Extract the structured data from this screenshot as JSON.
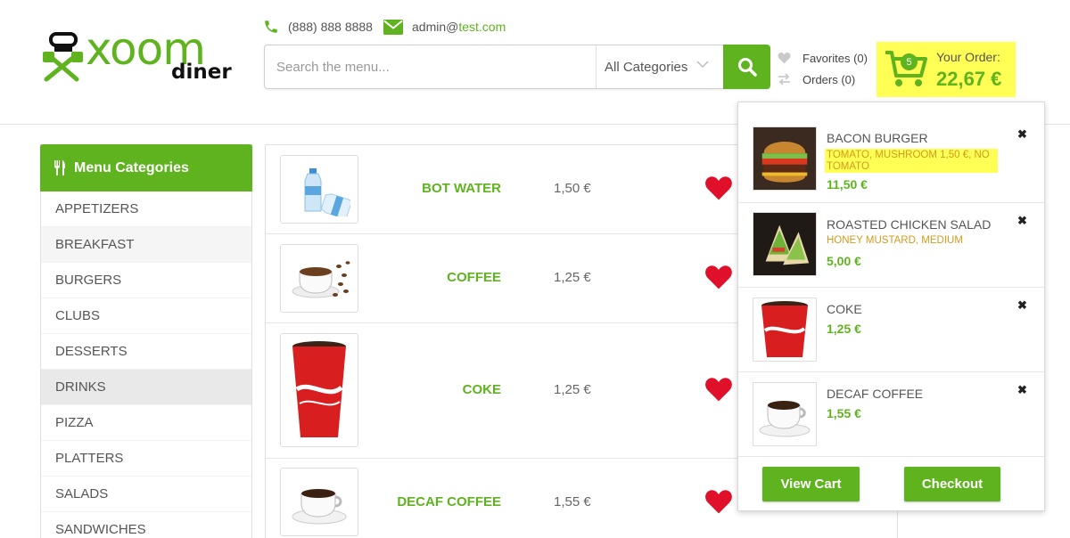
{
  "header": {
    "logo": {
      "word": "xoom",
      "sub": "diner"
    },
    "phone": "(888) 888 8888",
    "email_user": "admin@",
    "email_domain": "test.com",
    "search_placeholder": "Search the menu...",
    "category_select": "All Categories",
    "favorites": "Favorites (0)",
    "orders": "Orders (0)",
    "order_label": "Your Order:",
    "order_total": "22,67 €",
    "cart_count": "5"
  },
  "sidebar": {
    "title": "Menu Categories",
    "items": [
      {
        "label": "APPETIZERS"
      },
      {
        "label": "BREAKFAST"
      },
      {
        "label": "BURGERS"
      },
      {
        "label": "CLUBS"
      },
      {
        "label": "DESSERTS"
      },
      {
        "label": "DRINKS"
      },
      {
        "label": "PIZZA"
      },
      {
        "label": "PLATTERS"
      },
      {
        "label": "SALADS"
      },
      {
        "label": "SANDWICHES"
      }
    ]
  },
  "products": [
    {
      "name": "BOT WATER",
      "price": "1,50 €",
      "icon": "water-bottle-image"
    },
    {
      "name": "COFFEE",
      "price": "1,25 €",
      "icon": "coffee-cup-image"
    },
    {
      "name": "COKE",
      "price": "1,25 €",
      "icon": "coke-cup-image"
    },
    {
      "name": "DECAF COFFEE",
      "price": "1,55 €",
      "icon": "coffee-cup-image"
    }
  ],
  "cart": {
    "items": [
      {
        "name": "BACON BURGER",
        "options": "TOMATO, MUSHROOM 1,50 €, NO TOMATO",
        "price": "11,50 €"
      },
      {
        "name": "ROASTED CHICKEN SALAD",
        "options": "HONEY MUSTARD, MEDIUM",
        "price": "5,00 €"
      },
      {
        "name": "COKE",
        "options": "",
        "price": "1,25 €"
      },
      {
        "name": "DECAF COFFEE",
        "options": "",
        "price": "1,55 €"
      }
    ],
    "remove_glyph": "✖",
    "view_cart": "View Cart",
    "checkout": "Checkout"
  },
  "colors": {
    "accent": "#5fb31f",
    "highlight": "#ffff55",
    "option_text": "#d39b1b",
    "heart": "#e0102a"
  }
}
